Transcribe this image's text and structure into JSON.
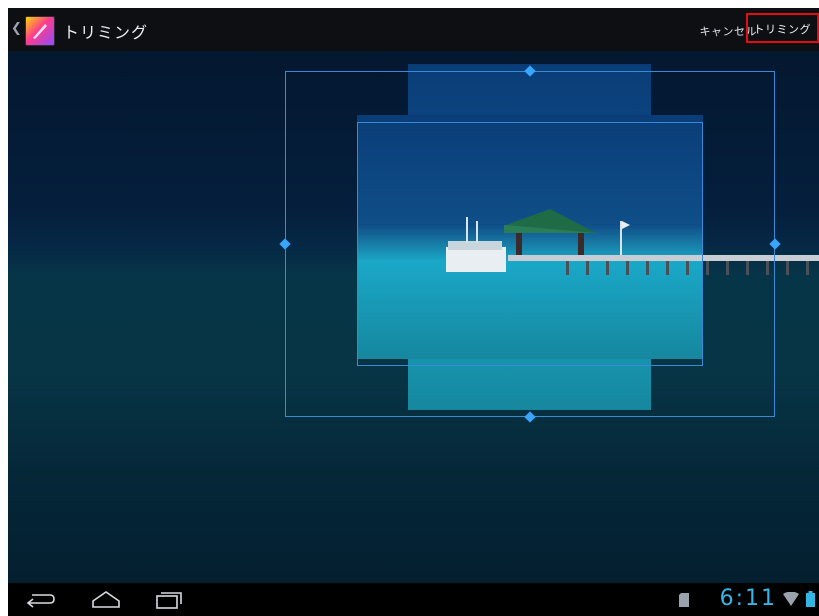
{
  "actionbar": {
    "title": "トリミング",
    "cancel_label": "キャンセル",
    "crop_label": "トリミング"
  },
  "statusbar": {
    "time": "6:11"
  },
  "icons": {
    "up": "chevron-left-icon",
    "app": "gallery-icon",
    "back": "back-icon",
    "home": "home-icon",
    "recents": "recent-apps-icon",
    "sd": "sd-card-icon",
    "wifi": "wifi-icon",
    "battery": "battery-icon"
  },
  "colors": {
    "accent": "#33b5e5",
    "crop_handle": "#38a5ff",
    "highlight_border": "#e10d12"
  }
}
